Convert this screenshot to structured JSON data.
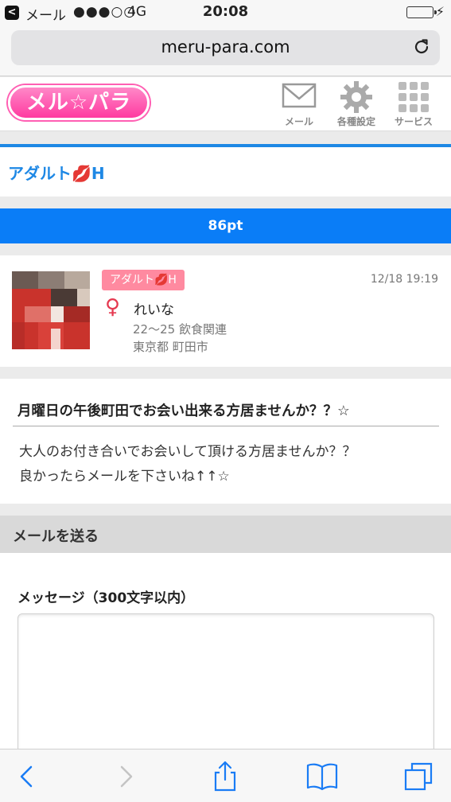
{
  "status_bar": {
    "back_app": "メール",
    "signal": "●●●○○",
    "network": "4G",
    "time": "20:08",
    "battery_level": 1.0
  },
  "browser": {
    "url": "meru-para.com"
  },
  "app_header": {
    "logo_text": "メル☆パラ",
    "nav": [
      {
        "label": "メール",
        "icon": "mail-icon"
      },
      {
        "label": "各種設定",
        "icon": "gear-icon"
      },
      {
        "label": "サービス",
        "icon": "grid-icon"
      }
    ]
  },
  "category": {
    "title": "アダルト💋H"
  },
  "points": "86pt",
  "profile": {
    "tag": "アダルト💋H",
    "date": "12/18 19:19",
    "gender_symbol": "♀",
    "name": "れいな",
    "age_job": "22〜25 飲食関連",
    "location": "東京都 町田市"
  },
  "post": {
    "title": "月曜日の午後町田でお会い出来る方居ませんか？？☆",
    "body_line1": "大人のお付き合いでお会いして頂ける方居ませんか？？",
    "body_line2": "良かったらメールを下さいね↑↑☆"
  },
  "send_mail": {
    "header": "メールを送る",
    "label": "メッセージ（300文字以内）",
    "placeholder": ""
  },
  "colors": {
    "accent_blue": "#1e88e5",
    "points_bar": "#0a7df7",
    "tag_pink": "#ff8aa0",
    "logo_pink": "#ff3aa0",
    "gender_red": "#e53950"
  }
}
